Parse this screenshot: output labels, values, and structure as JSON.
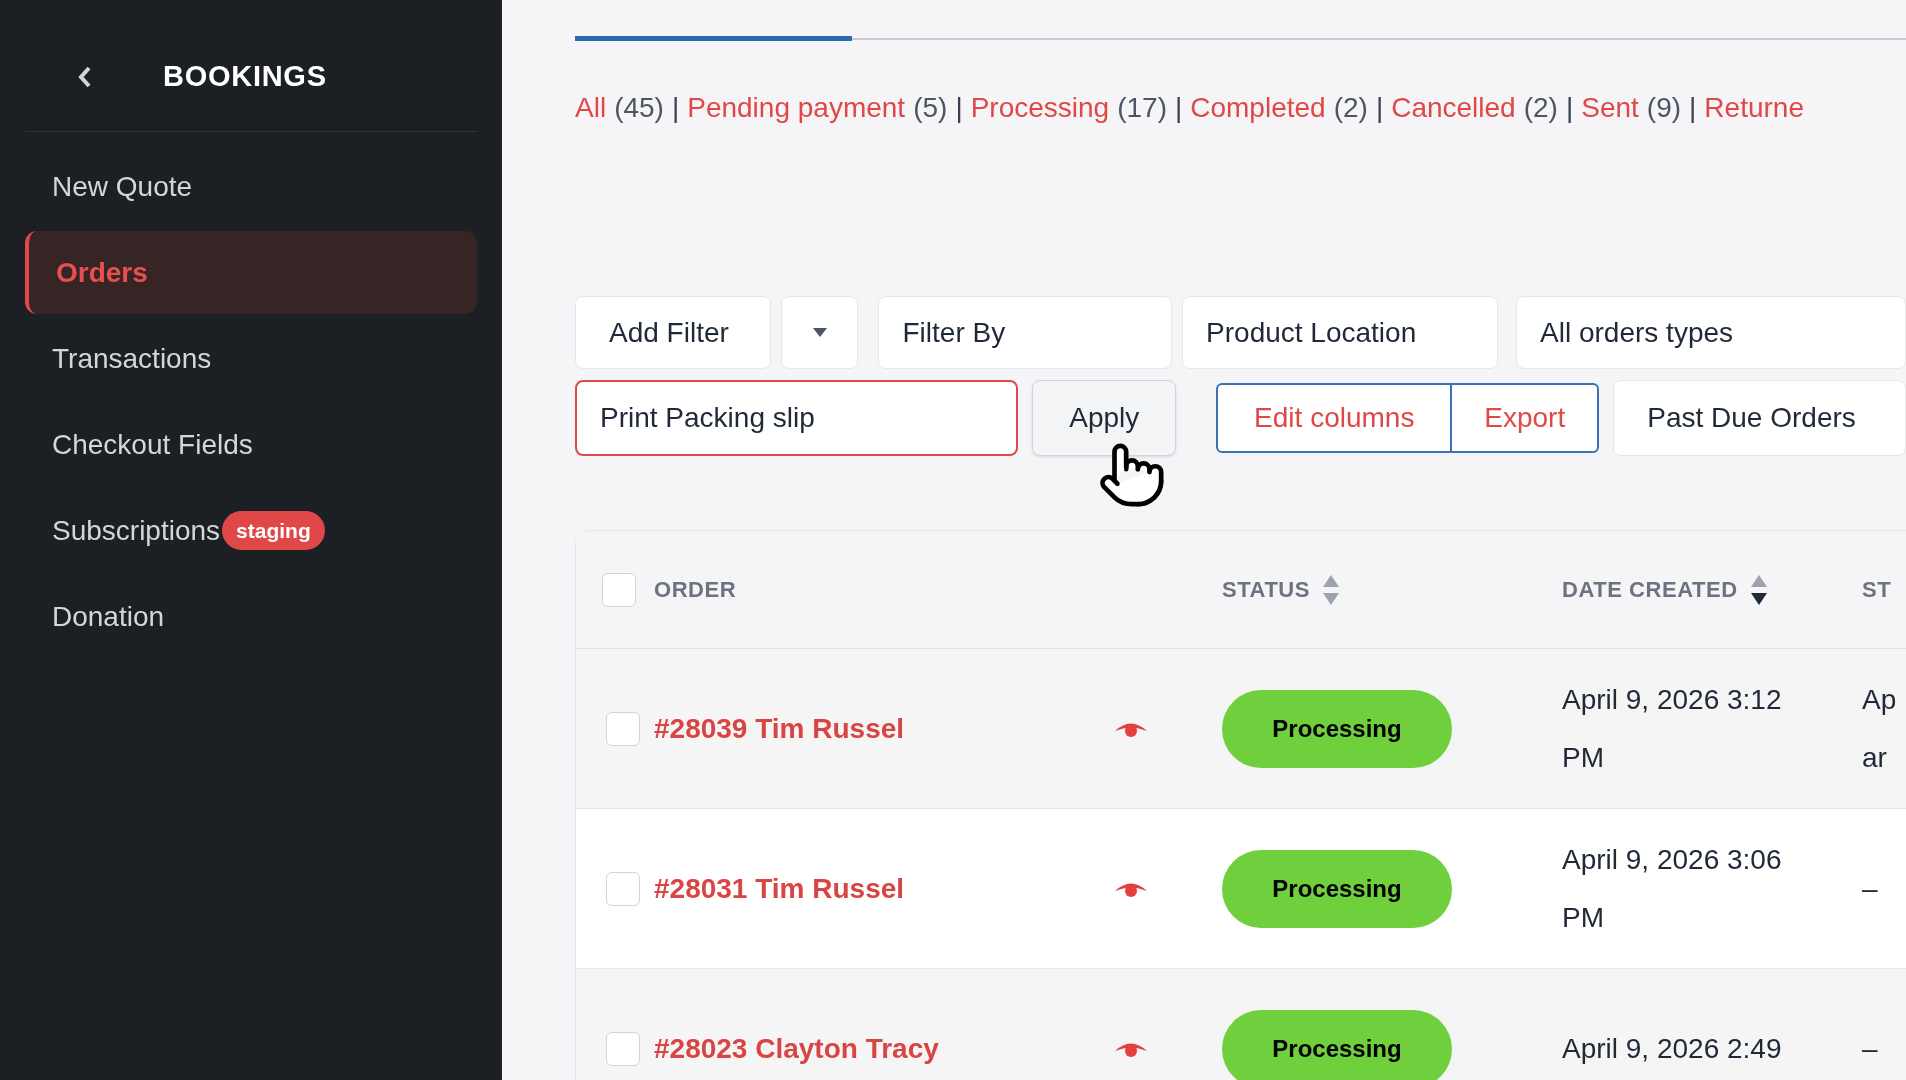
{
  "sidebar": {
    "title": "BOOKINGS",
    "items": [
      {
        "label": "New Quote",
        "selected": false
      },
      {
        "label": "Orders",
        "selected": true
      },
      {
        "label": "Transactions",
        "selected": false
      },
      {
        "label": "Checkout Fields",
        "selected": false
      },
      {
        "label": "Subscriptions",
        "selected": false,
        "badge": "staging"
      },
      {
        "label": "Donation",
        "selected": false
      }
    ]
  },
  "status_filters": {
    "separator": "|",
    "items": [
      {
        "label": "All",
        "count": "(45)"
      },
      {
        "label": "Pending payment",
        "count": "(5)"
      },
      {
        "label": "Processing",
        "count": "(17)"
      },
      {
        "label": "Completed",
        "count": "(2)"
      },
      {
        "label": "Cancelled",
        "count": "(2)"
      },
      {
        "label": "Sent",
        "count": "(9)"
      },
      {
        "label": "Returne"
      }
    ]
  },
  "filter_bar": {
    "add_filter": "Add Filter",
    "filter_by": "Filter By",
    "product_location": "Product Location",
    "order_types": "All orders types",
    "action_field": {
      "value": "Print Packing slip"
    },
    "apply": "Apply",
    "edit_columns": "Edit columns",
    "export": "Export",
    "past_due": "Past Due Orders"
  },
  "table": {
    "all_checked": false,
    "columns": [
      {
        "label": "ORDER"
      },
      {
        "label": "STATUS",
        "sort_desc": false
      },
      {
        "label": "DATE CREATED",
        "sort_desc": true
      },
      {
        "label": "ST"
      }
    ],
    "rows": [
      {
        "checked": false,
        "order": "#28039 Tim Russel",
        "status": "Processing",
        "date": [
          "April 9, 2026 3:12",
          "PM"
        ],
        "column_4": [
          "Ap",
          "ar"
        ]
      },
      {
        "checked": false,
        "order": "#28031 Tim Russel",
        "status": "Processing",
        "date": [
          "April 9, 2026 3:06",
          "PM"
        ],
        "column_4": [
          "–"
        ]
      },
      {
        "checked": false,
        "order": "#28023 Clayton Tracy",
        "status": "Processing",
        "date": [
          "April 9, 2026 2:49"
        ],
        "column_4": [
          "–"
        ]
      }
    ]
  }
}
